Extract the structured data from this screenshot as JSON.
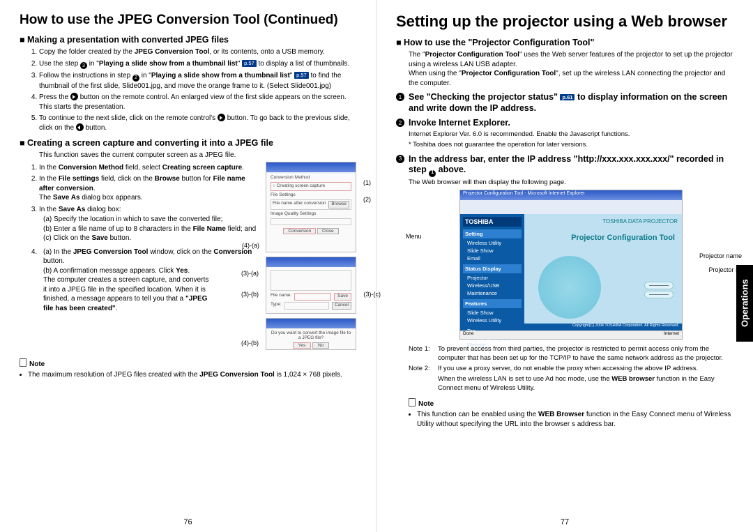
{
  "left": {
    "title": "How to use the JPEG Conversion Tool (Continued)",
    "sec1": {
      "h": "Making a presentation with converted JPEG files",
      "s1a": "Copy the folder created by the ",
      "s1b": "JPEG Conversion Tool",
      "s1c": ", or its contents, onto a USB memory.",
      "s2a": "Use the step ",
      "s2b": " in \"",
      "s2c": "Playing a slide show from a thumbnail list",
      "s2d": "\" ",
      "s2ref": "p.57",
      "s2e": " to display a list of thumbnails.",
      "s3a": "Follow the instructions in step ",
      "s3b": " in \"",
      "s3c": "Playing a slide show from a thumbnail list",
      "s3d": "\" ",
      "s3ref": "p.57",
      "s3e": " to find the thumbnail of the first slide, Slide001.jpg, and move the orange frame to it. (Select Slide001.jpg)",
      "s4a": "Press the ",
      "s4b": " button on the remote control. An enlarged view of the first slide appears on the screen. This starts the presentation.",
      "s5a": "To continue to the next slide, click on the remote control's ",
      "s5b": " button. To go back to the previous slide, click on the ",
      "s5c": " button."
    },
    "sec2": {
      "h": "Creating a screen capture and converting it into a JPEG file",
      "intro": "This function saves the current computer screen as a JPEG file.",
      "s1a": "In the ",
      "s1b": "Conversion Method",
      "s1c": " field, select ",
      "s1d": "Creating screen capture",
      "s1e": ".",
      "s2a": "In the ",
      "s2b": "File settings",
      "s2c": " field, click on the ",
      "s2d": "Browse",
      "s2e": " button for ",
      "s2f": "File name after conversion",
      "s2g": ".",
      "s2h": "The ",
      "s2i": "Save As",
      "s2j": " dialog box appears.",
      "s3a": "In the ",
      "s3b": "Save As",
      "s3c": " dialog box:",
      "s3sa": "(a) Specify the location in which to save the converted file;",
      "s3sb1": "(b) Enter a file name of up to 8 characters in the ",
      "s3sb2": "File Name",
      "s3sb3": " field; and",
      "s3sc1": "(c) Click on the ",
      "s3sc2": "Save",
      "s3sc3": " button.",
      "s4a1": "(a) In the ",
      "s4a2": "JPEG Conversion Tool",
      "s4a3": " window, click on the ",
      "s4a4": "Conversion",
      "s4a5": " button.",
      "s4b1": "(b) A confirmation message appears. Click ",
      "s4b2": "Yes",
      "s4b3": ".",
      "s4c": "The computer creates a screen capture, and converts it into a JPEG file in the specified location. When it is finished, a message appears to tell you that a ",
      "s4d": "\"JPEG file has been created\"",
      "s4e": "."
    },
    "noteh": "Note",
    "note1a": "The maximum resolution of JPEG files created with the ",
    "note1b": "JPEG Conversion Tool",
    "note1c": " is 1,024 × 768 pixels.",
    "cl1": "(1)",
    "cl2": "(2)",
    "cl3a": "(3)-(a)",
    "cl3b": "(3)-(b)",
    "cl3c": "(3)-(c)",
    "cl4a": "(4)-(a)",
    "cl4b": "(4)-(b)",
    "pnum": "76"
  },
  "right": {
    "title": "Setting up the projector using a Web browser",
    "sec_h": "How to use the \"Projector Configuration Tool\"",
    "intro1a": "The \"",
    "intro1b": "Projector Configuration Tool",
    "intro1c": "\" uses the Web server features of the projector to set up the projector using a wireless LAN USB adapter.",
    "intro2a": "When using the \"",
    "intro2b": "Projector Configuration Tool",
    "intro2c": "\", set up the wireless LAN connecting the projector and the computer.",
    "st1a": "See \"Checking the projector status\" ",
    "st1ref": "p.61",
    "st1b": " to display information on the screen and write down the IP address.",
    "st2": "Invoke Internet Explorer.",
    "st2s1": "Internet Explorer Ver. 6.0 is recommended. Enable the Javascript functions.",
    "st2s2": "* Toshiba does not guarantee the operation for later versions.",
    "st3a": "In the address bar, enter the IP address \"http://xxx.xxx.xxx.xxx/\" recorded in step ",
    "st3b": " above.",
    "st3s": "The Web browser will then display the following page.",
    "fig": {
      "wintitle": "Projector Configuration Tool - Microsoft Internet Explorer",
      "logo": "TOSHIBA",
      "g1": "Setting",
      "g1a": "Wireless Utility",
      "g1b": "Slide Show",
      "g1c": "Email",
      "g2": "Status Display",
      "g2a": "Projector",
      "g2b": "Wireless/USB",
      "g2c": "Maintenance",
      "g3": "Features",
      "g3a": "Slide Show",
      "g3b": "Wireless Utility",
      "top": "Top",
      "tplink": "TOSHIBA Projector Website",
      "brand": "TOSHIBA DATA PROJECTOR",
      "tool": "Projector Configuration Tool",
      "done": "Done",
      "inet": "Internet",
      "cpr": "Copyright(C) 2004 TOSHIBA Corporation. All Rights Reserved."
    },
    "lbl_menu": "Menu",
    "lbl_pn": "Projector name",
    "lbl_pid": "Projector ID",
    "n1k": "Note 1:",
    "n1": "To prevent access from third parties, the projector is restricted to permit access only from the computer that has been set up for the TCP/IP to have the same network address as the projector.",
    "n2k": "Note 2:",
    "n2a": "If you use a proxy server, do not enable the proxy when accessing the above IP address.",
    "n2b1": "When the wireless LAN is set to use Ad hoc mode, use the ",
    "n2b2": "WEB browser",
    "n2b3": " function in the Easy Connect menu of Wireless Utility.",
    "noteh": "Note",
    "nb1a": "This function can be enabled using the ",
    "nb1b": "WEB Browser",
    "nb1c": " function in the Easy Connect menu of Wireless Utility without specifying the URL into the browser s address bar.",
    "sidetab": "Operations",
    "pnum": "77"
  }
}
